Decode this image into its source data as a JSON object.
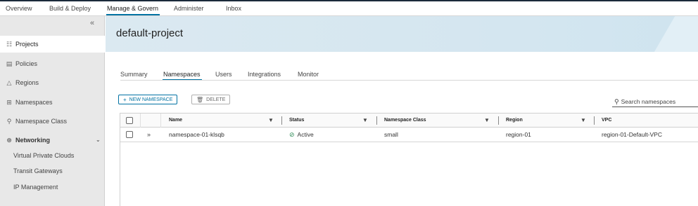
{
  "topnav": {
    "tabs": [
      "Overview",
      "Build & Deploy",
      "Manage & Govern",
      "Administer",
      "Inbox"
    ],
    "active_tab": "Manage & Govern"
  },
  "sidebar": {
    "collapse_icon": "double-chevron-left-icon",
    "items": [
      {
        "label": "Projects",
        "icon": "projects-icon",
        "active": true
      },
      {
        "label": "Policies",
        "icon": "policies-icon"
      },
      {
        "label": "Regions",
        "icon": "regions-icon"
      },
      {
        "label": "Namespaces",
        "icon": "namespaces-icon"
      },
      {
        "label": "Namespace Class",
        "icon": "namespace-class-icon"
      },
      {
        "label": "Networking",
        "icon": "networking-icon",
        "expanded": true
      }
    ],
    "networking_children": [
      "Virtual Private Clouds",
      "Transit Gateways",
      "IP Management"
    ]
  },
  "page": {
    "title": "default-project"
  },
  "subtabs": {
    "tabs": [
      "Summary",
      "Namespaces",
      "Users",
      "Integrations",
      "Monitor"
    ],
    "active_tab": "Namespaces"
  },
  "actions": {
    "new_label": "NEW NAMESPACE",
    "delete_label": "DELETE"
  },
  "search": {
    "placeholder": "Search namespaces"
  },
  "table": {
    "columns": [
      "Name",
      "Status",
      "Namespace Class",
      "Region",
      "VPC"
    ],
    "rows": [
      {
        "name": "namespace-01-klsqb",
        "status": "Active",
        "namespace_class": "small",
        "region": "region-01",
        "vpc": "region-01-Default-VPC"
      }
    ]
  },
  "colors": {
    "accent": "#0072a3",
    "status_active": "#2e8b57",
    "sidebar_bg": "#e8e8e8",
    "banner_bg": "#d4e6f0"
  }
}
